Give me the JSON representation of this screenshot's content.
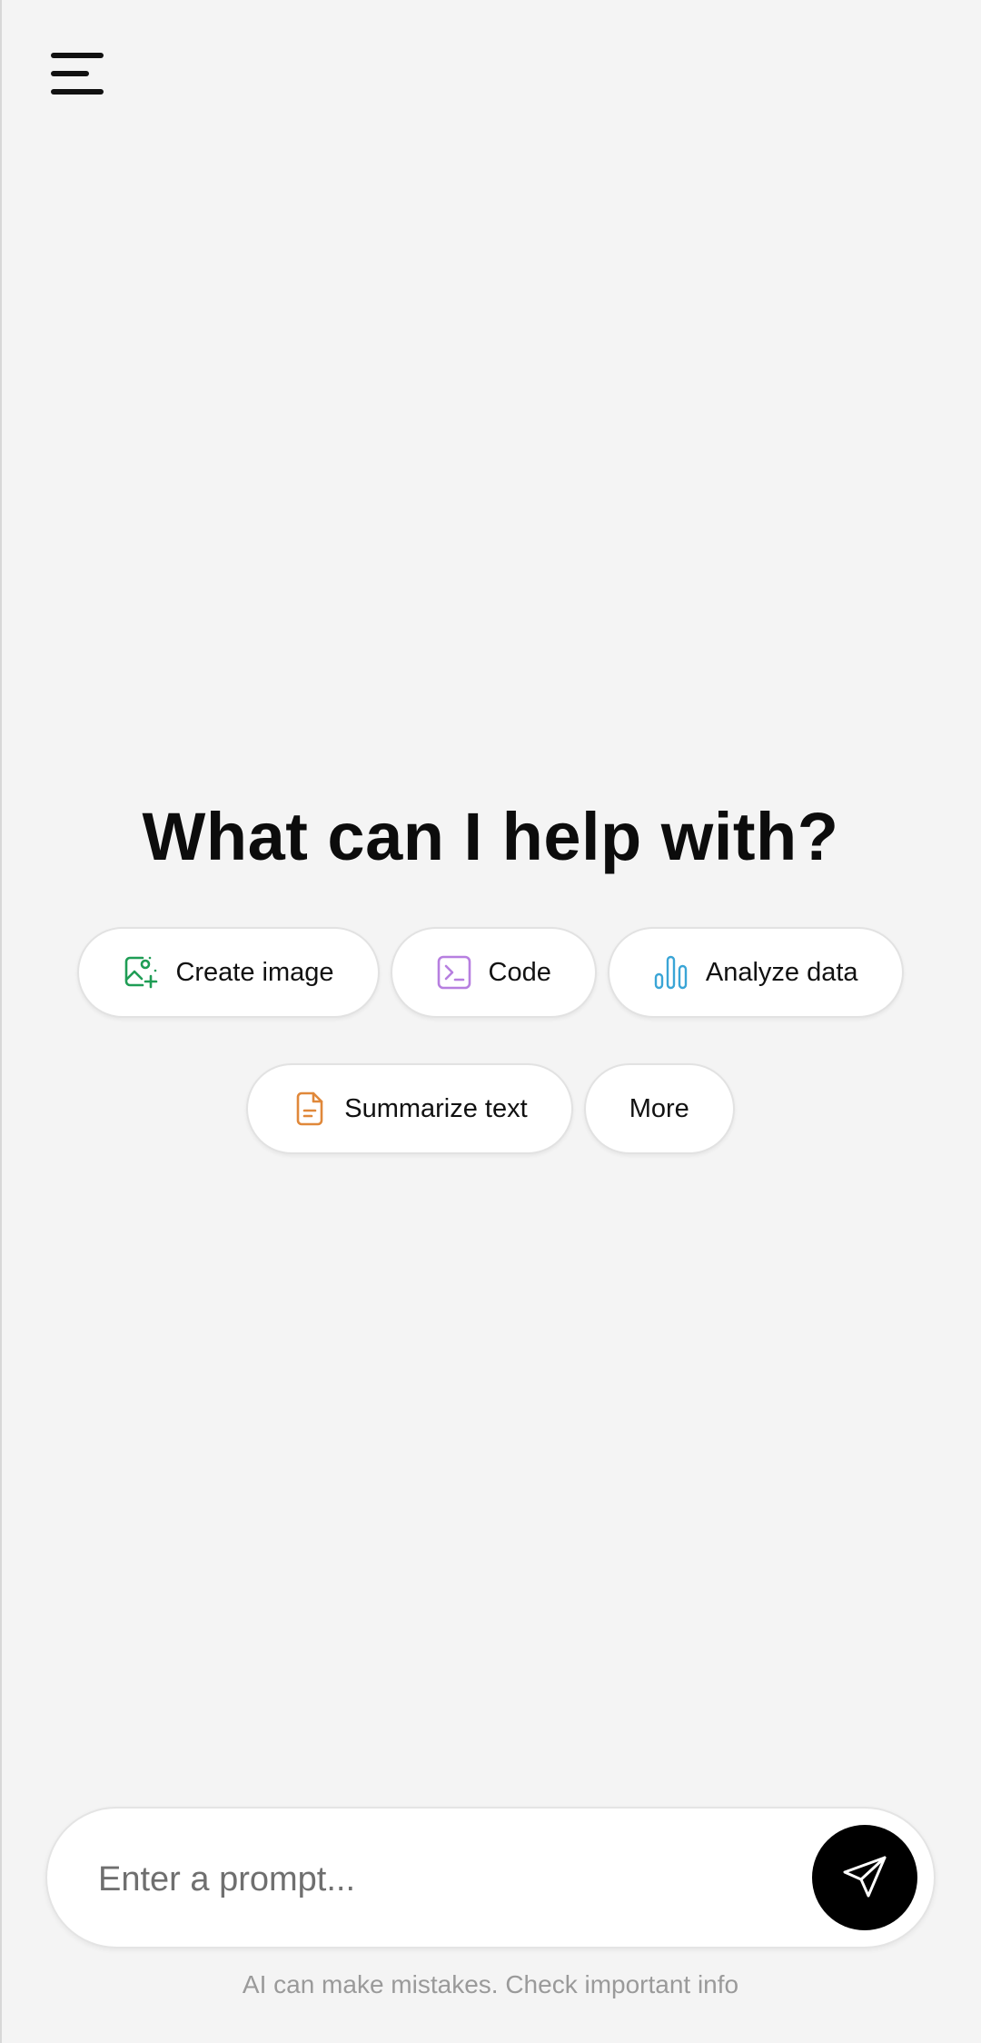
{
  "header": {
    "menu_icon": "hamburger-menu-icon"
  },
  "main": {
    "headline": "What can I help with?",
    "chips_row1": [
      {
        "label": "Create image",
        "icon": "image-plus-icon",
        "color": "#1f9d55"
      },
      {
        "label": "Code",
        "icon": "terminal-icon",
        "color": "#b77fe0"
      },
      {
        "label": "Analyze data",
        "icon": "bar-chart-icon",
        "color": "#3aa5d6"
      }
    ],
    "chips_row2": [
      {
        "label": "Summarize text",
        "icon": "document-icon",
        "color": "#e0883a"
      },
      {
        "label": "More",
        "icon": null
      }
    ]
  },
  "composer": {
    "placeholder": "Enter a prompt...",
    "send_icon": "send-icon",
    "disclaimer": "AI can make mistakes. Check important info"
  }
}
